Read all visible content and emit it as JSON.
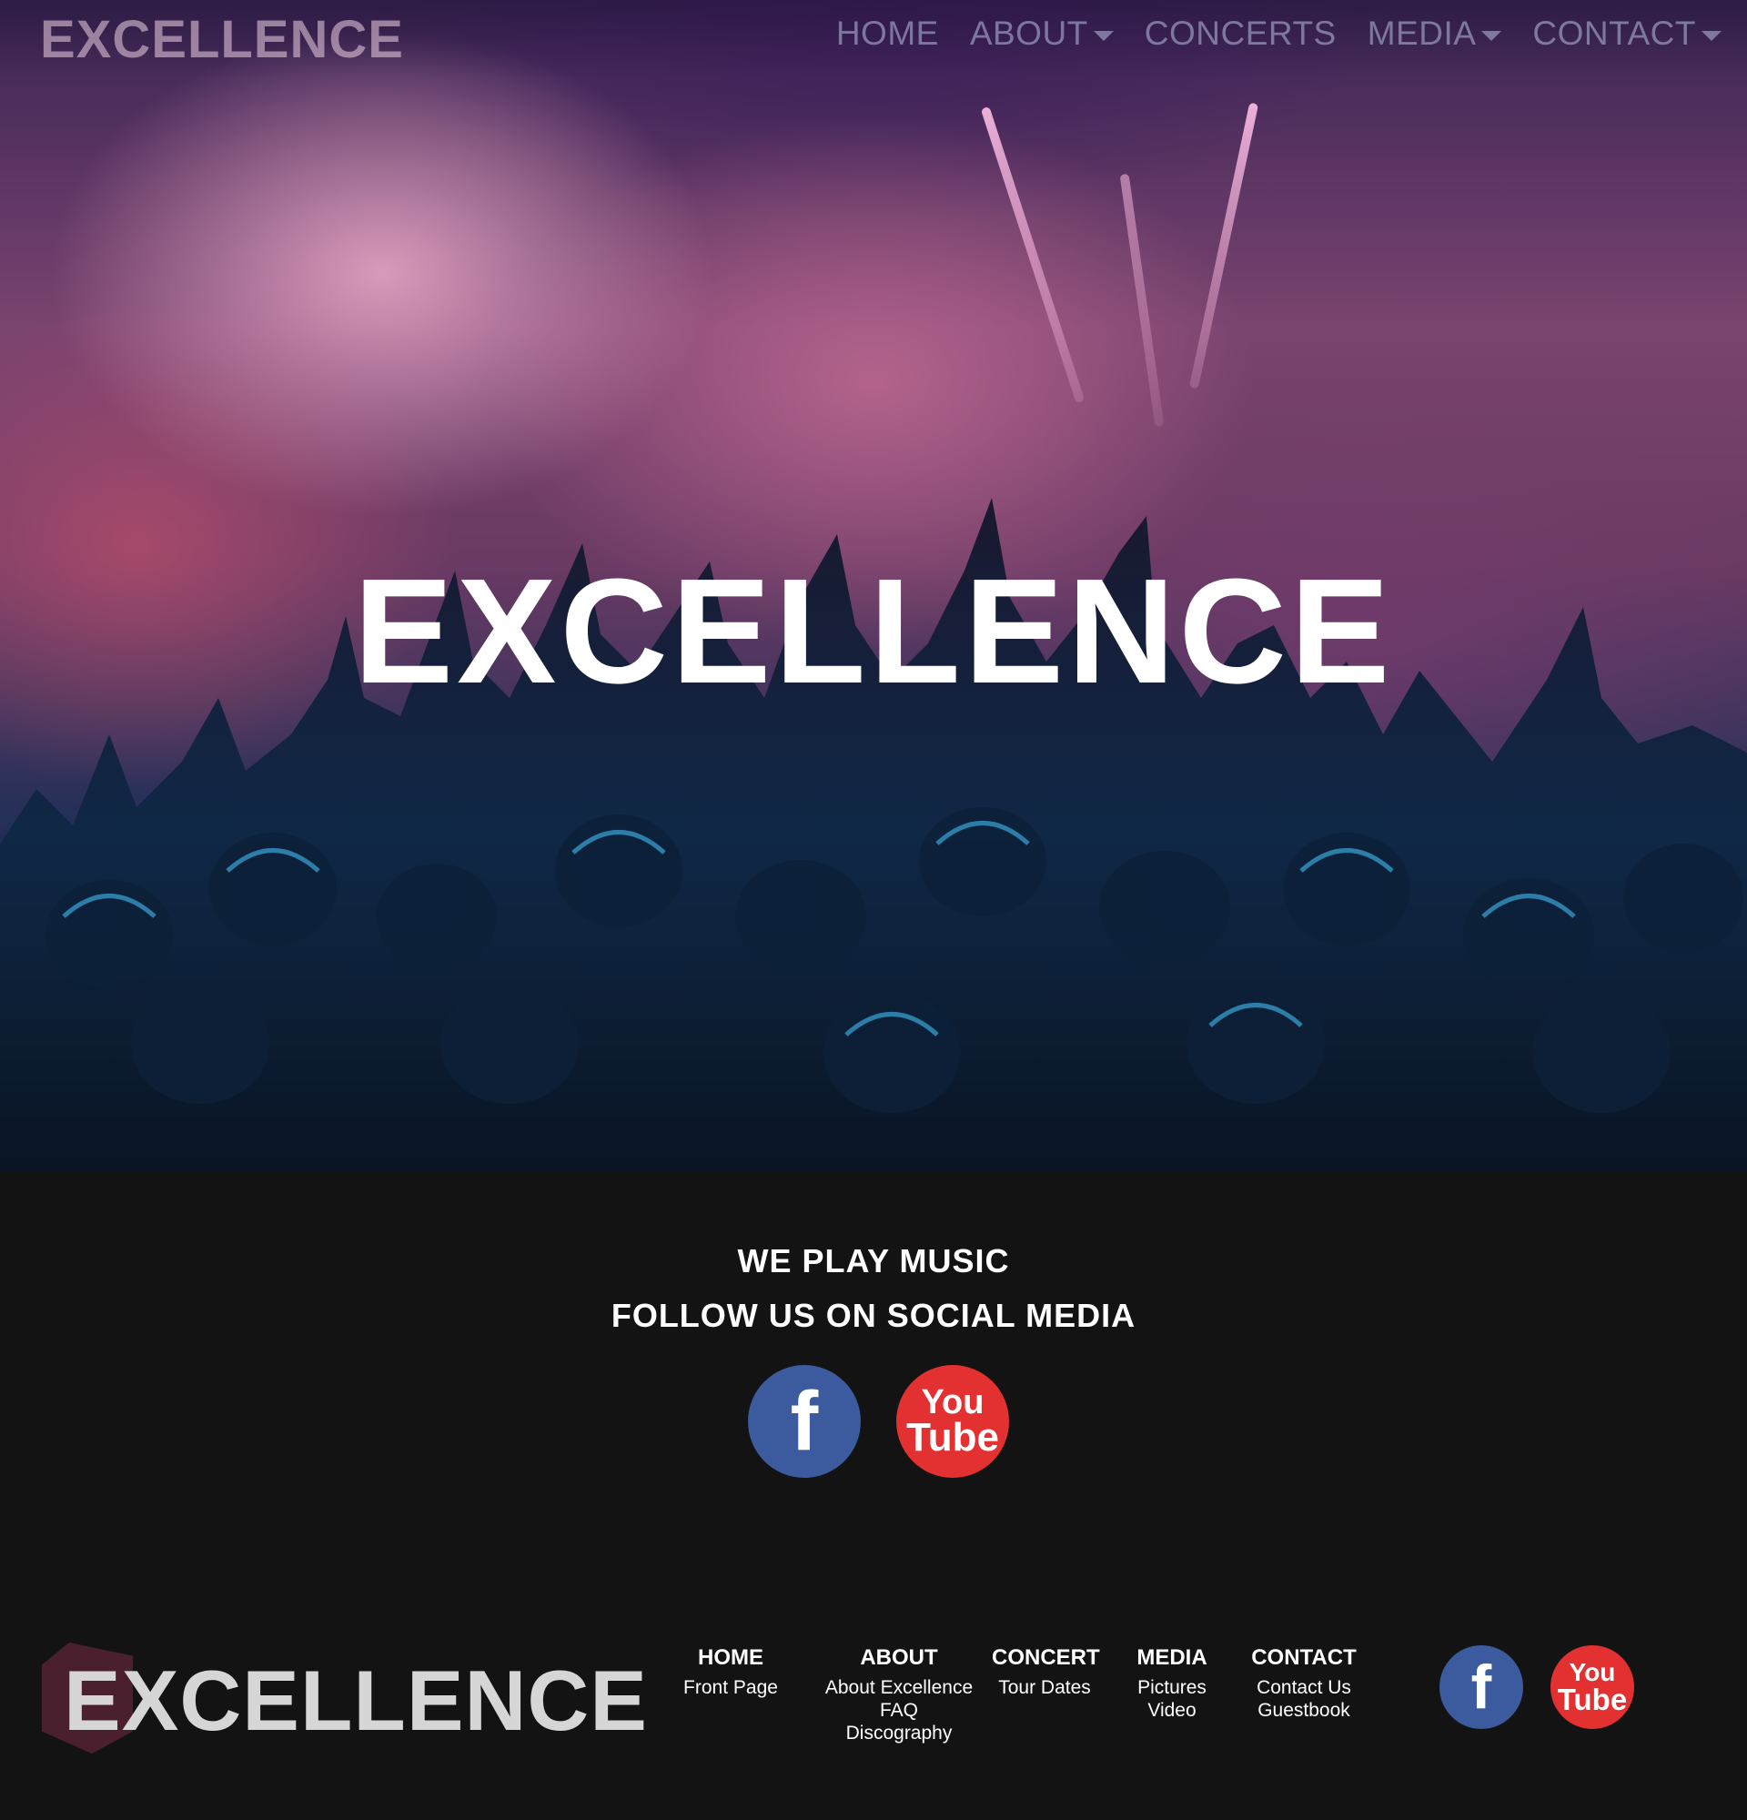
{
  "nav": {
    "logo": "EXCELLENCE",
    "items": [
      {
        "label": "HOME",
        "dropdown": false
      },
      {
        "label": "ABOUT",
        "dropdown": true
      },
      {
        "label": "CONCERTS",
        "dropdown": false
      },
      {
        "label": "MEDIA",
        "dropdown": true
      },
      {
        "label": "CONTACT",
        "dropdown": true
      }
    ]
  },
  "hero": {
    "title": "EXCELLENCE"
  },
  "band": {
    "line1": "WE PLAY MUSIC",
    "line2": "FOLLOW US ON SOCIAL MEDIA",
    "facebook_icon_text": "f",
    "youtube_icon_text_top": "You",
    "youtube_icon_text_bottom": "Tube"
  },
  "footer": {
    "logo": "EXCELLENCE",
    "columns": [
      {
        "heading": "HOME",
        "links": [
          "Front Page"
        ]
      },
      {
        "heading": "ABOUT",
        "links": [
          "About Excellence",
          "FAQ",
          "Discography"
        ]
      },
      {
        "heading": "CONCERT",
        "links": [
          "Tour Dates"
        ]
      },
      {
        "heading": "MEDIA",
        "links": [
          "Pictures",
          "Video"
        ]
      },
      {
        "heading": "CONTACT",
        "links": [
          "Contact Us",
          "Guestbook"
        ]
      }
    ]
  },
  "colors": {
    "background": "#131313",
    "facebook": "#3b5b9e",
    "youtube": "#e33132",
    "logo_hex": "#4a1f2e"
  },
  "icons": [
    "facebook-icon",
    "youtube-icon",
    "chevron-down-icon"
  ]
}
